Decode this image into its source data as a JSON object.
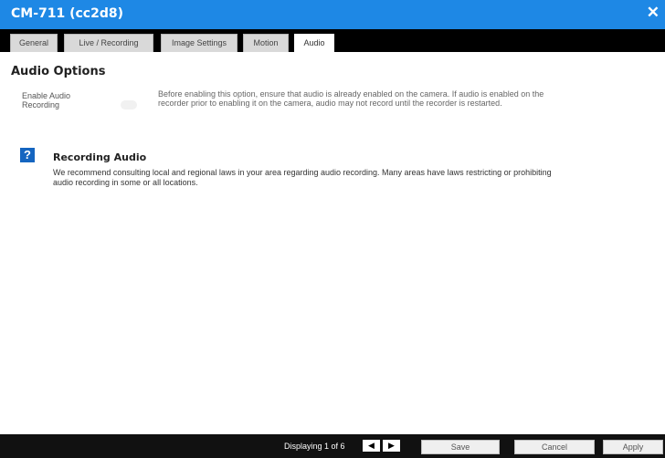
{
  "window": {
    "title": "CM-711 (cc2d8)",
    "close_glyph": "✕"
  },
  "tabs": [
    {
      "label": "General"
    },
    {
      "label": "Live / Recording"
    },
    {
      "label": "Image Settings"
    },
    {
      "label": "Motion"
    },
    {
      "label": "Audio",
      "active": true
    }
  ],
  "audio_options": {
    "heading": "Audio Options",
    "enable_label": "Enable Audio Recording",
    "enabled": false,
    "description": "Before enabling this option, ensure that audio is already enabled on the camera. If audio is enabled on the recorder prior to enabling it on the camera, audio may not record until the recorder is restarted."
  },
  "info": {
    "icon": "question-icon",
    "icon_glyph": "?",
    "heading": "Recording Audio",
    "text": "We recommend consulting local and regional laws in your area regarding audio recording. Many areas have laws restricting or prohibiting audio recording in some or all locations."
  },
  "footer": {
    "displaying": "Displaying 1 of 6",
    "prev_glyph": "◀",
    "next_glyph": "▶",
    "save": "Save",
    "cancel": "Cancel",
    "apply": "Apply"
  },
  "colors": {
    "accent": "#1e88e5",
    "icon_blue": "#1565c0"
  }
}
